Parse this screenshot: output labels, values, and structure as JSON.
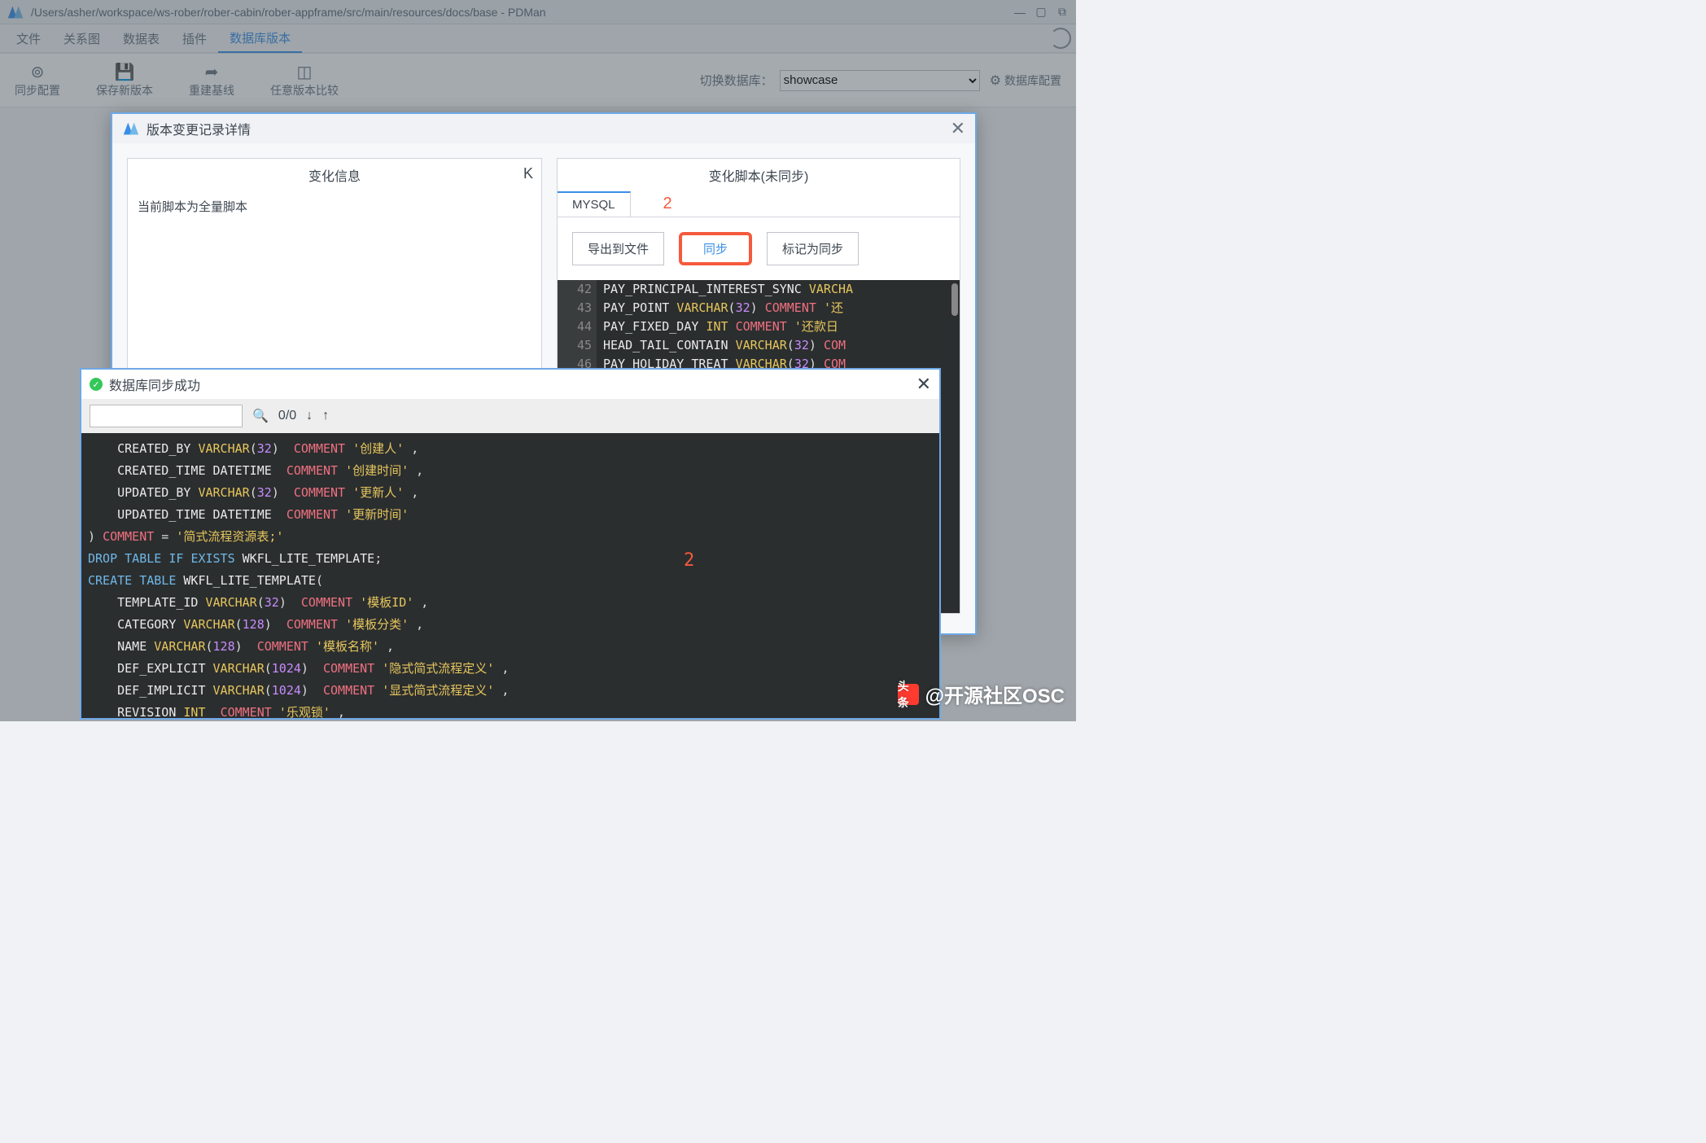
{
  "titlebar": {
    "path": "/Users/asher/workspace/ws-rober/rober-cabin/rober-appframe/src/main/resources/docs/base - PDMan"
  },
  "menu": {
    "items": [
      "文件",
      "关系图",
      "数据表",
      "插件",
      "数据库版本"
    ],
    "activeIndex": 4
  },
  "toolbar": {
    "sync_config": "同步配置",
    "save_version": "保存新版本",
    "rebuild_baseline": "重建基线",
    "compare_versions": "任意版本比较",
    "switch_db_label": "切换数据库：",
    "db_selected": "showcase",
    "db_config": "数据库配置"
  },
  "modal_detail": {
    "title": "版本变更记录详情",
    "left": {
      "title": "变化信息",
      "k": "K",
      "note": "当前脚本为全量脚本"
    },
    "right": {
      "title": "变化脚本(未同步)",
      "tab": "MYSQL",
      "annot": "2",
      "btn_export": "导出到文件",
      "btn_sync": "同步",
      "btn_mark": "标记为同步",
      "lines": [
        {
          "n": "42",
          "html": "<span class='id'>PAY_PRINCIPAL_INTEREST_SYNC</span> <span class='ty'>VARCHA</span>"
        },
        {
          "n": "43",
          "html": "<span class='id'>PAY_POINT</span> <span class='ty'>VARCHAR</span>(<span class='num'>32</span>)  <span class='cmt'>COMMENT</span> <span class='str'>'还</span>"
        },
        {
          "n": "44",
          "html": "<span class='id'>PAY_FIXED_DAY</span> <span class='ty'>INT</span>  <span class='cmt'>COMMENT</span> <span class='str'>'还款日</span>"
        },
        {
          "n": "45",
          "html": "<span class='id'>HEAD_TAIL_CONTAIN</span> <span class='ty'>VARCHAR</span>(<span class='num'>32</span>)  <span class='cmt'>COM</span>"
        },
        {
          "n": "46",
          "html": "<span class='id'>PAY_HOLIDAY_TREAT</span> <span class='ty'>VARCHAR</span>(<span class='num'>32</span>)  <span class='cmt'>COM</span>"
        }
      ]
    }
  },
  "modal_sync": {
    "title": "数据库同步成功",
    "search_count": "0/0",
    "annot": "2",
    "lines": [
      "    <span class='id'>CREATED_BY</span> <span class='ty'>VARCHAR</span>(<span class='num'>32</span>)  <span class='cmt'>COMMENT</span> <span class='str'>'创建人'</span> ,",
      "    <span class='id'>CREATED_TIME</span> <span class='id'>DATETIME</span>  <span class='cmt'>COMMENT</span> <span class='str'>'创建时间'</span> ,",
      "    <span class='id'>UPDATED_BY</span> <span class='ty'>VARCHAR</span>(<span class='num'>32</span>)  <span class='cmt'>COMMENT</span> <span class='str'>'更新人'</span> ,",
      "    <span class='id'>UPDATED_TIME</span> <span class='id'>DATETIME</span>  <span class='cmt'>COMMENT</span> <span class='str'>'更新时间'</span>",
      ") <span class='cmt'>COMMENT</span> = <span class='str'>'简式流程资源表;'</span>",
      "<span class='kw'>DROP</span> <span class='kw'>TABLE</span> <span class='kw'>IF</span> <span class='kw'>EXISTS</span> <span class='id'>WKFL_LITE_TEMPLATE</span>;",
      "<span class='kw'>CREATE</span> <span class='kw'>TABLE</span> <span class='id'>WKFL_LITE_TEMPLATE</span>(",
      "    <span class='id'>TEMPLATE_ID</span> <span class='ty'>VARCHAR</span>(<span class='num'>32</span>)  <span class='cmt'>COMMENT</span> <span class='str'>'模板ID'</span> ,",
      "    <span class='id'>CATEGORY</span> <span class='ty'>VARCHAR</span>(<span class='num'>128</span>)  <span class='cmt'>COMMENT</span> <span class='str'>'模板分类'</span> ,",
      "    <span class='id'>NAME</span> <span class='ty'>VARCHAR</span>(<span class='num'>128</span>)  <span class='cmt'>COMMENT</span> <span class='str'>'模板名称'</span> ,",
      "    <span class='id'>DEF_EXPLICIT</span> <span class='ty'>VARCHAR</span>(<span class='num'>1024</span>)  <span class='cmt'>COMMENT</span> <span class='str'>'隐式简式流程定义'</span> ,",
      "    <span class='id'>DEF_IMPLICIT</span> <span class='ty'>VARCHAR</span>(<span class='num'>1024</span>)  <span class='cmt'>COMMENT</span> <span class='str'>'显式简式流程定义'</span> ,",
      "    <span class='id'>REVISION</span> <span class='ty'>INT</span>  <span class='cmt'>COMMENT</span> <span class='str'>'乐观锁'</span> ,"
    ]
  },
  "watermark": {
    "label": "头条",
    "text": "@开源社区OSC"
  }
}
